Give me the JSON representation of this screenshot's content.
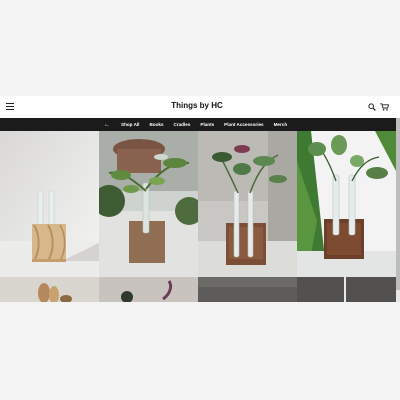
{
  "header": {
    "site_title": "Things by HC"
  },
  "nav": {
    "back_arrow": "←",
    "items": [
      "Shop All",
      "Books",
      "Cradles",
      "Plants",
      "Plant Accessories",
      "Merch"
    ]
  },
  "icons": {
    "menu": "hamburger-menu-icon",
    "search": "search-icon",
    "cart": "cart-icon",
    "back": "arrow-left-icon"
  },
  "colors": {
    "nav_background": "#1b1b1b",
    "header_background": "#ffffff",
    "page_background": "#f3f3f3"
  },
  "products": [
    {
      "subject": "natural wood cradle with two glass tubes, no plant"
    },
    {
      "subject": "walnut cradle with glass tube and leafy plant"
    },
    {
      "subject": "walnut cradle with two glass tubes and calathea"
    },
    {
      "subject": "walnut cradle with two glass tubes and watermelon peperomia"
    },
    {
      "subject": "partial product photo, second row"
    },
    {
      "subject": "partial product photo, second row"
    },
    {
      "subject": "partial product photo, second row"
    },
    {
      "subject": "partial product photo, second row"
    }
  ]
}
